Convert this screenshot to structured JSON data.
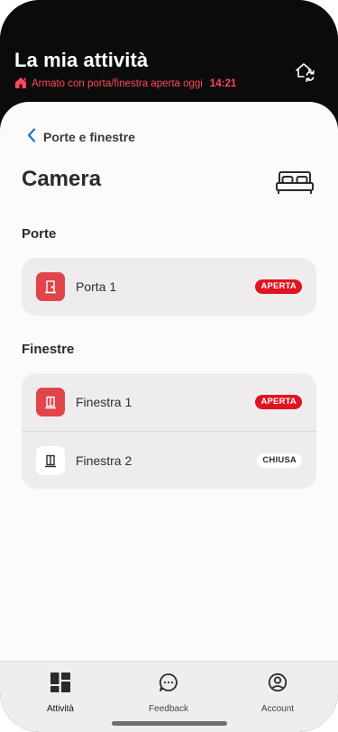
{
  "header": {
    "title": "La mia attività",
    "status_text": "Armato con porta/finestra aperta oggi",
    "status_time": "14:21",
    "status_icon": "house-alert-icon",
    "sync_icon": "home-sync-icon"
  },
  "nav": {
    "back_label": "Porte e finestre"
  },
  "room": {
    "title": "Camera",
    "icon": "bed-icon"
  },
  "sections": {
    "doors": {
      "title": "Porte",
      "items": [
        {
          "label": "Porta 1",
          "status": "APERTA"
        }
      ]
    },
    "windows": {
      "title": "Finestre",
      "items": [
        {
          "label": "Finestra 1",
          "status": "APERTA"
        },
        {
          "label": "Finestra 2",
          "status": "CHIUSA"
        }
      ]
    }
  },
  "tabbar": {
    "items": [
      {
        "label": "Attività",
        "icon": "dashboard-icon",
        "active": true
      },
      {
        "label": "Feedback",
        "icon": "chat-bubble-icon",
        "active": false
      },
      {
        "label": "Account",
        "icon": "account-icon",
        "active": false
      }
    ]
  },
  "colors": {
    "alert_red": "#e0131e",
    "icon_red": "#e1454c",
    "status_text_red": "#ff4a55",
    "header_bg": "#0b0b0b",
    "link_blue": "#1f6fd1"
  }
}
